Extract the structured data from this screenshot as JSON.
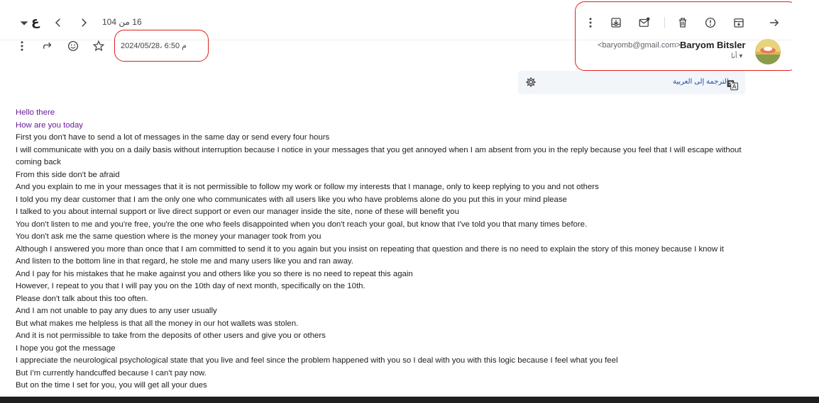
{
  "toolbar": {
    "pager": "16 من 104",
    "input_lang": "ع",
    "icons": [
      "dropdown-arrow-icon",
      "prev-chevron-icon",
      "next-chevron-icon",
      "more-vert-icon",
      "download-icon",
      "mark-unread-icon",
      "trash-icon",
      "report-spam-icon",
      "move-to-archive-icon",
      "forward-arrow-icon"
    ]
  },
  "message": {
    "date": "2024/05/28، 6:50 م",
    "sender_name": "Baryom Bitsler",
    "sender_email": "<baryomb@gmail.com>",
    "to": "أنا"
  },
  "translate": {
    "label": "الترجمة إلى العربية"
  },
  "body": {
    "lines": [
      "Hello there",
      "How are you today",
      "First you don't have to send a lot of messages in the same day or send every four hours",
      "I will communicate with you on a daily basis without interruption because I notice in your messages that you get annoyed when I am absent from you in the reply because you feel that I will escape without coming back",
      "From this side don't be afraid",
      "And you explain to me in your messages that it is not permissible to follow my work or follow my interests that I manage, only to keep replying to you and not others",
      "I told you my dear customer that I am the only one who communicates with all users like you who have problems alone do you put this in your mind please",
      "I talked to you about internal support or live direct support or even our manager inside the site, none of these will benefit you",
      "You don't listen to me and you're free, you're the one who feels disappointed when you don't reach your goal, but know that I've told you that many times before.",
      "You don't ask me the same question where is the money your manager took from you",
      "Although I answered you more than once that I am committed to send it to you again but you insist on repeating that question and there is no need to explain the story of this money because I know it",
      "And listen to the bottom line in that regard, he stole me and many users like you and ran away.",
      "And I pay for his mistakes that he make against you and others like you so there is no need to repeat this again",
      "However, I repeat to you that I will pay you on the 10th day of next month, specifically on the 10th.",
      "Please don't talk about this too often.",
      "And I am not unable to pay any dues to any user usually",
      "But what makes me helpless is that all the money in our hot wallets was stolen.",
      "And it is not permissible to take from the deposits of other users and give you or others",
      "I hope you got the message",
      "I appreciate the neurological psychological state that you live and feel since the problem happened with you so I deal with you with this logic because I feel what you feel",
      "But I'm currently handcuffed because I can't pay now.",
      "But on the time I set for you, you will get all your dues"
    ]
  },
  "colors": {
    "annotation_red": "#e0201a",
    "greeting_purple": "#6a1b9a",
    "translate_bg": "#f2f6fb"
  }
}
